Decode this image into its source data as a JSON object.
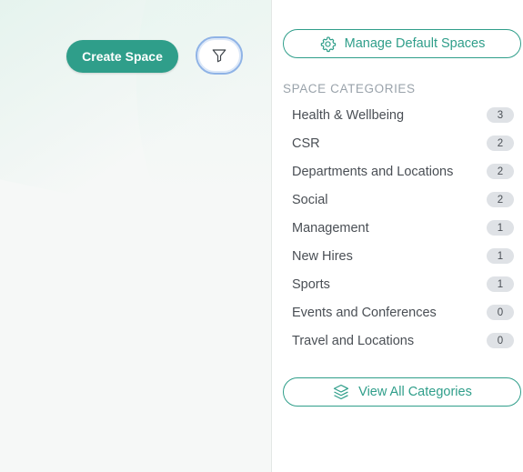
{
  "left": {
    "create_label": "Create Space",
    "filter_icon": "filter-icon"
  },
  "right": {
    "manage_label": "Manage Default Spaces",
    "manage_icon": "gear-icon",
    "section_title": "SPACE CATEGORIES",
    "categories": [
      {
        "label": "Health & Wellbeing",
        "count": "3"
      },
      {
        "label": "CSR",
        "count": "2"
      },
      {
        "label": "Departments and Locations",
        "count": "2"
      },
      {
        "label": "Social",
        "count": "2"
      },
      {
        "label": "Management",
        "count": "1"
      },
      {
        "label": "New Hires",
        "count": "1"
      },
      {
        "label": "Sports",
        "count": "1"
      },
      {
        "label": "Events and Conferences",
        "count": "0"
      },
      {
        "label": "Travel and Locations",
        "count": "0"
      }
    ],
    "view_all_label": "View All Categories",
    "view_all_icon": "layers-icon"
  },
  "colors": {
    "accent": "#2f9e8a",
    "badge_bg": "#dfe2e6",
    "muted_text": "#9aa3ab",
    "filter_focus": "#8fb3e6"
  }
}
